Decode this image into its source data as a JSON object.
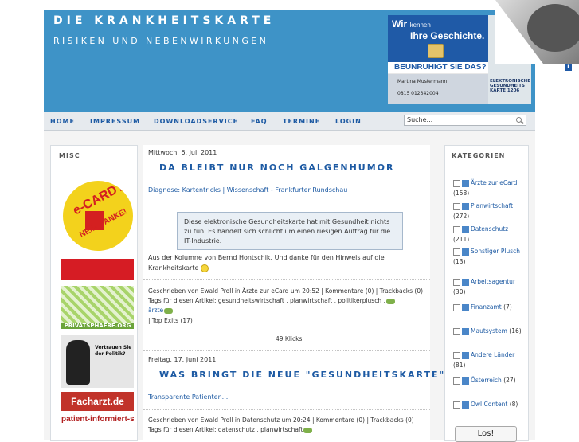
{
  "header": {
    "title": "DIE KRANKHEITSKARTE",
    "subtitle": "RISIKEN UND NEBENWIRKUNGEN"
  },
  "banner": {
    "line1": "Wir",
    "line1_small": "kennen",
    "line2": "Ihre Geschichte.",
    "question": "BEUNRUHIGT SIE DAS?",
    "name": "Martina Mustermann",
    "number": "0815    012342004",
    "card_label": "ELEKTRONISCHE GESUNDHEITS KARTE 1206"
  },
  "nav": {
    "items": [
      "HOME",
      "IMPRESSUM",
      "DOWNLOADSERVICE",
      "FAQ",
      "TERMINE",
      "LOGIN"
    ],
    "search_value": "Suche..."
  },
  "left": {
    "title": "MISC",
    "ad_ecard": "e-CARD?",
    "ad_nein": "NEIN DANKE!",
    "ad_privat": "PRIVATSPHAERE.ORG",
    "ad_vertrauen": "Vertrauen Sie der Politik?",
    "ad_facharzt": "Facharzt.de",
    "ad_patient": "patient-informiert-sich.de"
  },
  "posts": [
    {
      "date": "Mittwoch, 6. Juli 2011",
      "title": "DA BLEIBT NUR NOCH GALGENHUMOR",
      "diagnose_label": "Diagnose:",
      "diagnose_text": "Kartentricks | Wissenschaft - Frankfurter Rundschau",
      "quote": "Diese elektronische Gesundheitskarte hat mit Gesundheit nichts zu tun. Es handelt sich schlicht um einen riesigen Auftrag für die IT-Industrie.",
      "body1": "Aus der Kolumne von Bernd Hontschik. Und danke für den Hinweis auf die",
      "body2": "Krankheitskarte",
      "meta": "Geschrieben von Ewald Proll in Ärzte zur eCard um 20:52 | Kommentare (0) | Trackbacks (0)",
      "tags": "Tags für diesen Artikel: gesundheitswirtschaft , planwirtschaft , politikerplusch ,",
      "tags2": "ärzte",
      "top_exits": "| Top Exits (17)",
      "clicks": "49 Klicks"
    },
    {
      "date": "Freitag, 17. Juni 2011",
      "title": "WAS BRINGT DIE NEUE \"GESUNDHEITSKARTE\"?",
      "teaser": "Transparente Patienten...",
      "meta": "Geschrieben von Ewald Proll in Datenschutz um 20:24 | Kommentare (0) | Trackbacks (0)",
      "tags": "Tags für diesen Artikel: datenschutz , planwirtschaft"
    }
  ],
  "right": {
    "title": "KATEGORIEN",
    "categories": [
      {
        "label": "Ärzte zur eCard",
        "count": "(158)"
      },
      {
        "label": "Planwirtschaft",
        "count": "(272)"
      },
      {
        "label": "Datenschutz",
        "count": "(211)"
      },
      {
        "label": "Sonstiger Plusch",
        "count": "(13)"
      },
      {
        "label": "Arbeitsagentur",
        "count": "(30)"
      },
      {
        "label": "Finanzamt",
        "count": "(7)"
      },
      {
        "label": "Mautsystem",
        "count": "(16)"
      },
      {
        "label": "Andere Länder",
        "count": "(81)"
      },
      {
        "label": "Österreich",
        "count": "(27)"
      },
      {
        "label": "Owl Content",
        "count": "(8)"
      }
    ],
    "button": "Los!"
  },
  "colors": {
    "header_blue": "#3e93c7",
    "link_blue": "#1d5aa3"
  }
}
